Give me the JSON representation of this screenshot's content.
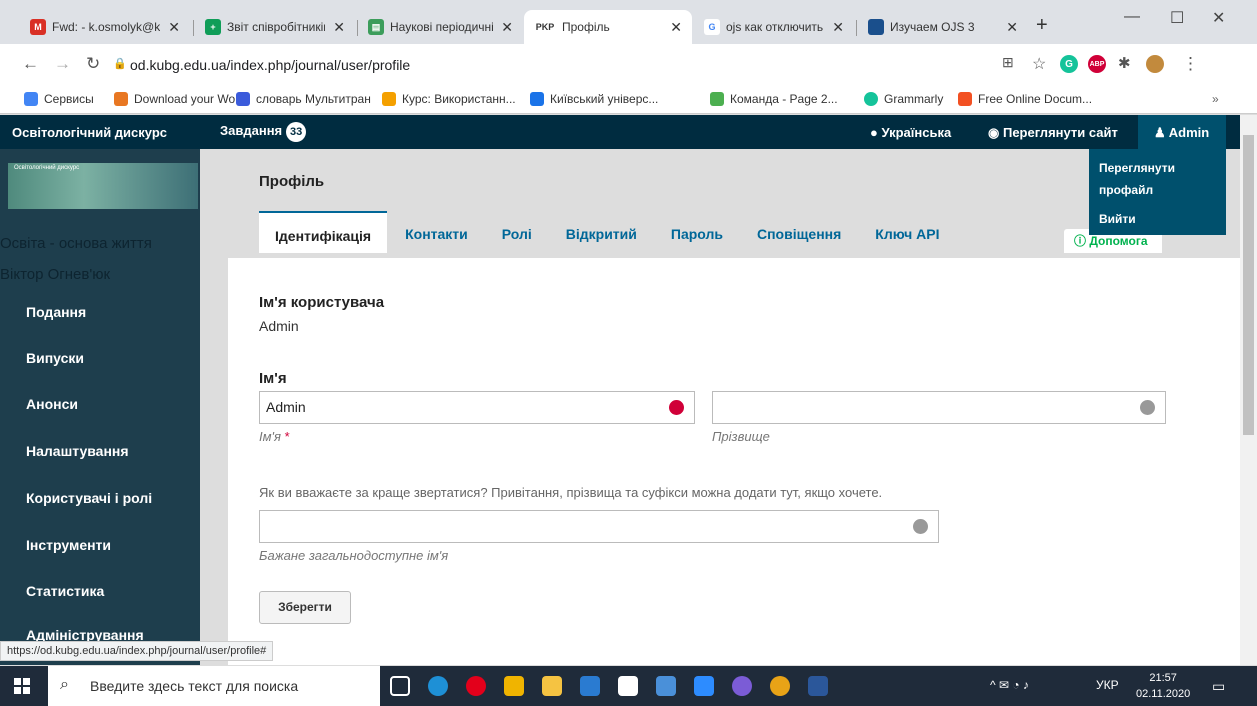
{
  "browser": {
    "tabs": [
      {
        "title": "Fwd: - k.osmolyk@k",
        "icon": "gmail-icon",
        "color": "#d93025"
      },
      {
        "title": "Звіт співробітників",
        "icon": "sheets-icon",
        "color": "#0f9d58"
      },
      {
        "title": "Наукові періодичні",
        "icon": "doc-icon",
        "color": "#3c9d5b"
      },
      {
        "title": "Профіль",
        "icon": "pkp-icon",
        "color": "#333333",
        "badge_text": "PKP"
      },
      {
        "title": "ojs как отключить",
        "icon": "google-icon",
        "color": "#4285f4",
        "badge_text": "G"
      },
      {
        "title": "Изучаем OJS 3",
        "icon": "site-icon",
        "color": "#1a4f8c"
      }
    ],
    "active_tab_index": 3,
    "url": "od.kubg.edu.ua/index.php/journal/user/profile",
    "bookmarks": [
      {
        "label": "Сервисы",
        "color": "#4285f4"
      },
      {
        "label": "Download your Wo...",
        "color": "#e87722"
      },
      {
        "label": "словарь Мультитран",
        "color": "#3b5bdb"
      },
      {
        "label": "Курс: Використанн...",
        "color": "#f4a000"
      },
      {
        "label": "Київський універс...",
        "color": "#1a73e8"
      },
      {
        "label": "Команда - Page 2...",
        "color": "#4caf50"
      },
      {
        "label": "Grammarly",
        "color": "#15c39a"
      },
      {
        "label": "Free Online Docum...",
        "color": "#f25022"
      }
    ]
  },
  "ojs": {
    "journal_name": "Освітологічний дискурс",
    "tasks_label": "Завдання",
    "tasks_count": "33",
    "language": "Українська",
    "view_site": "Переглянути сайт",
    "user": "Admin",
    "user_menu": [
      "Переглянути профайл",
      "Вийти"
    ],
    "sidebar_text": [
      "Освіта - основа життя",
      "Віктор Огнев'юк"
    ],
    "sidebar_items": [
      "Подання",
      "Випуски",
      "Анонси",
      "Налаштування",
      "Користувачі і ролі",
      "Інструменти",
      "Статистика",
      "Адміністрування"
    ],
    "page_title": "Профіль",
    "tabs": [
      "Ідентифікація",
      "Контакти",
      "Ролі",
      "Відкритий",
      "Пароль",
      "Сповіщення",
      "Ключ API"
    ],
    "help_label": "Допомога",
    "username_label": "Ім'я користувача",
    "username_value": "Admin",
    "name_heading": "Ім'я",
    "given_name_value": "Admin",
    "given_name_sub": "Ім'я",
    "family_name_value": "",
    "family_name_sub": "Прізвище",
    "preferred_hint": "Як ви вважаєте за краще звертатися? Привітання, прізвища та суфікси можна додати тут, якщо хочете.",
    "preferred_value": "",
    "preferred_sub": "Бажане загальнодоступне ім'я",
    "save_label": "Зберегти"
  },
  "status_url": "https://od.kubg.edu.ua/index.php/journal/user/profile#",
  "taskbar": {
    "search_placeholder": "Введите здесь текст для поиска",
    "lang": "УКР",
    "time": "21:57",
    "date": "02.11.2020"
  },
  "colors": {
    "header": "#002c40",
    "sidebar": "#1e3e4d",
    "link": "#006798",
    "required": "#d00038",
    "help": "#00b24e"
  }
}
